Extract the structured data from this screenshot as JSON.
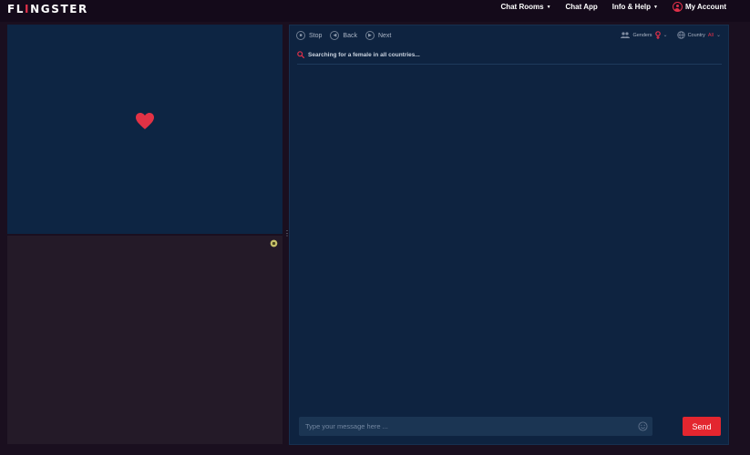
{
  "header": {
    "logo_left": "FL",
    "logo_mark": "I",
    "logo_right": "NGSTER",
    "nav": [
      {
        "label": "Chat Rooms",
        "has_caret": true
      },
      {
        "label": "Chat App",
        "has_caret": false
      },
      {
        "label": "Info & Help",
        "has_caret": true
      }
    ],
    "account_label": "My Account"
  },
  "stranger": {
    "icon": "heart-icon"
  },
  "chat": {
    "controls": [
      {
        "label": "Stop",
        "icon": "stop-icon"
      },
      {
        "label": "Back",
        "icon": "back-icon"
      },
      {
        "label": "Next",
        "icon": "next-icon"
      }
    ],
    "genders_label": "Genders",
    "country_label": "Country",
    "country_value": "All",
    "status_text": "Searching for a female in all countries...",
    "composer_placeholder": "Type your message here ...",
    "send_label": "Send"
  },
  "colors": {
    "accent": "#e03049",
    "panel": "#0e2340",
    "send": "#e3262f"
  }
}
